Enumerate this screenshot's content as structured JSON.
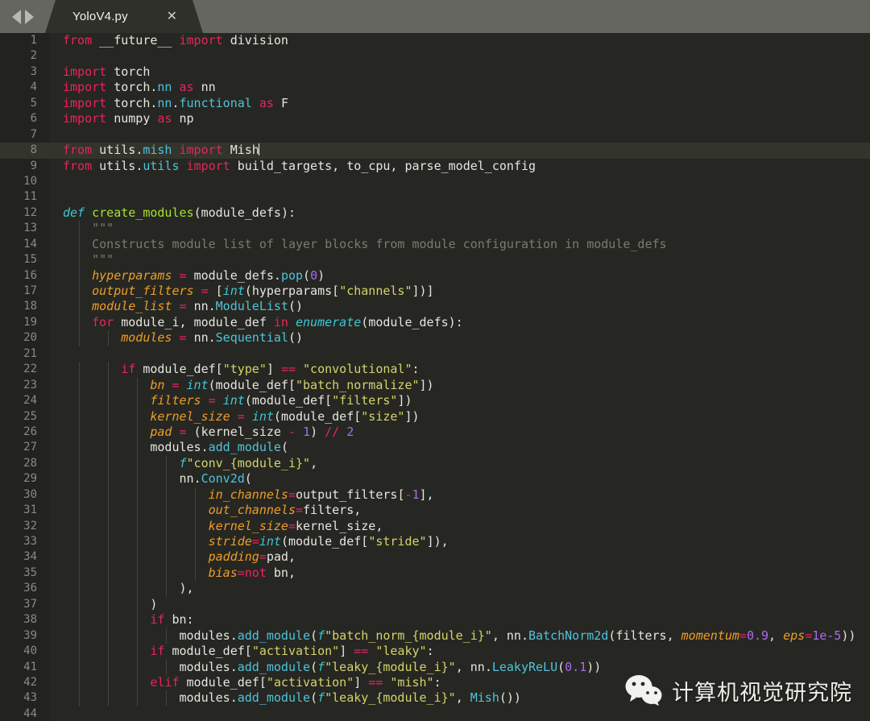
{
  "window": {
    "nav": {
      "back_label": "◀",
      "forward_label": "▶"
    },
    "tab": {
      "title": "YoloV4.py",
      "close_label": "✕"
    }
  },
  "editor": {
    "current_line": 8,
    "first_line": 1,
    "last_line": 44,
    "language": "Python",
    "colors": {
      "background": "#262722",
      "gutter": "#222320",
      "tabbar": "#666661",
      "active_tab": "#2f302a",
      "current_line_highlight": "#33342b",
      "keyword": "#e8245f",
      "string": "#d4d36a",
      "number": "#a96bec",
      "builtin": "#3bc9d8",
      "function_name": "#a6e22e",
      "parameter": "#ef9d28",
      "class_name": "#4fc3dd",
      "comment": "#7a7c6e",
      "plain_text": "#e6e6e1",
      "line_number": "#8a8a84"
    },
    "lines": [
      {
        "n": 1,
        "text": "from __future__ import division"
      },
      {
        "n": 2,
        "text": ""
      },
      {
        "n": 3,
        "text": "import torch"
      },
      {
        "n": 4,
        "text": "import torch.nn as nn"
      },
      {
        "n": 5,
        "text": "import torch.nn.functional as F"
      },
      {
        "n": 6,
        "text": "import numpy as np"
      },
      {
        "n": 7,
        "text": ""
      },
      {
        "n": 8,
        "text": "from utils.mish import Mish"
      },
      {
        "n": 9,
        "text": "from utils.utils import build_targets, to_cpu, parse_model_config"
      },
      {
        "n": 10,
        "text": ""
      },
      {
        "n": 11,
        "text": ""
      },
      {
        "n": 12,
        "text": "def create_modules(module_defs):"
      },
      {
        "n": 13,
        "text": "    \"\"\""
      },
      {
        "n": 14,
        "text": "    Constructs module list of layer blocks from module configuration in module_defs"
      },
      {
        "n": 15,
        "text": "    \"\"\""
      },
      {
        "n": 16,
        "text": "    hyperparams = module_defs.pop(0)"
      },
      {
        "n": 17,
        "text": "    output_filters = [int(hyperparams[\"channels\"])]"
      },
      {
        "n": 18,
        "text": "    module_list = nn.ModuleList()"
      },
      {
        "n": 19,
        "text": "    for module_i, module_def in enumerate(module_defs):"
      },
      {
        "n": 20,
        "text": "        modules = nn.Sequential()"
      },
      {
        "n": 21,
        "text": ""
      },
      {
        "n": 22,
        "text": "        if module_def[\"type\"] == \"convolutional\":"
      },
      {
        "n": 23,
        "text": "            bn = int(module_def[\"batch_normalize\"])"
      },
      {
        "n": 24,
        "text": "            filters = int(module_def[\"filters\"])"
      },
      {
        "n": 25,
        "text": "            kernel_size = int(module_def[\"size\"])"
      },
      {
        "n": 26,
        "text": "            pad = (kernel_size - 1) // 2"
      },
      {
        "n": 27,
        "text": "            modules.add_module("
      },
      {
        "n": 28,
        "text": "                f\"conv_{module_i}\","
      },
      {
        "n": 29,
        "text": "                nn.Conv2d("
      },
      {
        "n": 30,
        "text": "                    in_channels=output_filters[-1],"
      },
      {
        "n": 31,
        "text": "                    out_channels=filters,"
      },
      {
        "n": 32,
        "text": "                    kernel_size=kernel_size,"
      },
      {
        "n": 33,
        "text": "                    stride=int(module_def[\"stride\"]),"
      },
      {
        "n": 34,
        "text": "                    padding=pad,"
      },
      {
        "n": 35,
        "text": "                    bias=not bn,"
      },
      {
        "n": 36,
        "text": "                ),"
      },
      {
        "n": 37,
        "text": "            )"
      },
      {
        "n": 38,
        "text": "            if bn:"
      },
      {
        "n": 39,
        "text": "                modules.add_module(f\"batch_norm_{module_i}\", nn.BatchNorm2d(filters, momentum=0.9, eps=1e-5))"
      },
      {
        "n": 40,
        "text": "            if module_def[\"activation\"] == \"leaky\":"
      },
      {
        "n": 41,
        "text": "                modules.add_module(f\"leaky_{module_i}\", nn.LeakyReLU(0.1))"
      },
      {
        "n": 42,
        "text": "            elif module_def[\"activation\"] == \"mish\":"
      },
      {
        "n": 43,
        "text": "                modules.add_module(f\"leaky_{module_i}\", Mish())"
      },
      {
        "n": 44,
        "text": ""
      }
    ]
  },
  "watermark": {
    "icon": "wechat-icon",
    "text": "计算机视觉研究院"
  }
}
